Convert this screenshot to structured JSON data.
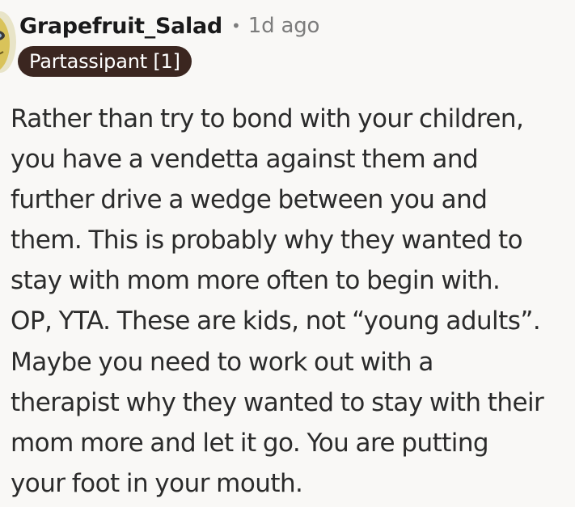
{
  "comment": {
    "username": "Grapefruit_Salad",
    "separator": "•",
    "timestamp": "1d ago",
    "flair": "Partassipant [1]",
    "body_lines": [
      "Rather than try to bond with your children,",
      "you have a vendetta against them and",
      "further drive a wedge between you and",
      "them. This is probably why they wanted to",
      "stay with mom more often to begin with.",
      "OP, YTA. These are kids, not “young adults”.",
      "Maybe you need to work out with a",
      "therapist why they wanted to stay with their",
      "mom more and let it go. You are putting",
      "your foot in your mouth."
    ]
  },
  "colors": {
    "background": "#f9f8f6",
    "username": "#1a1a1b",
    "meta": "#7c7c7c",
    "flair_bg": "#3b2620",
    "flair_text": "#ffffff",
    "body_text": "#2b2b2b"
  },
  "icons": {
    "avatar": "user-avatar"
  }
}
